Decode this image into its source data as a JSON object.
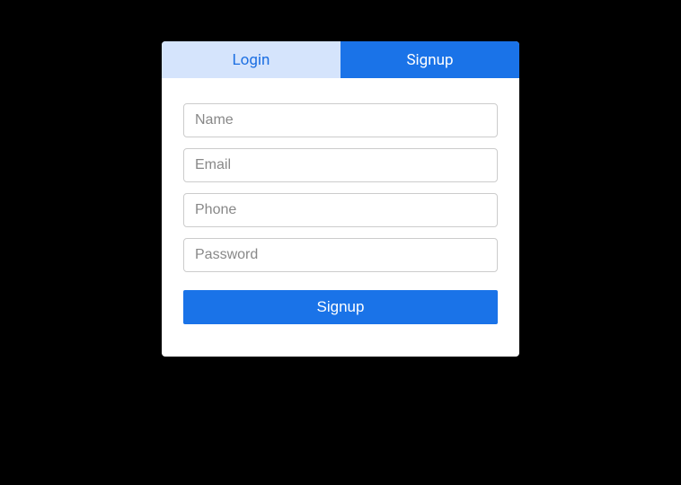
{
  "tabs": {
    "login": "Login",
    "signup": "Signup"
  },
  "fields": {
    "name": {
      "placeholder": "Name",
      "value": ""
    },
    "email": {
      "placeholder": "Email",
      "value": ""
    },
    "phone": {
      "placeholder": "Phone",
      "value": ""
    },
    "password": {
      "placeholder": "Password",
      "value": ""
    }
  },
  "submit": {
    "label": "Signup"
  }
}
